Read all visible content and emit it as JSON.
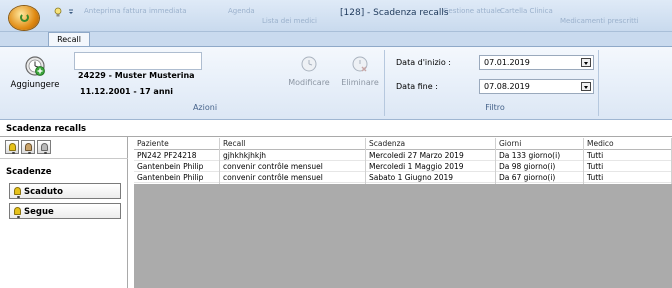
{
  "window": {
    "title": "[128] - Scadenza recalls",
    "ghost_items": [
      "Anteprima fattura immediata",
      "Agenda",
      "Lista dei medici",
      "Gestione attuale",
      "Cartella Clinica",
      "Medicamenti prescritti"
    ]
  },
  "ribbon": {
    "tab_label": "Recall",
    "actions": {
      "add_label": "Aggiungere",
      "patient_name": "24229 - Muster Musterina",
      "patient_dob": "11.12.2001 - 17 anni",
      "edit_label": "Modificare",
      "delete_label": "Eliminare",
      "group_label": "Azioni"
    },
    "filter": {
      "start_label": "Data d'inizio :",
      "start_value": "07.01.2019",
      "end_label": "Data fine :",
      "end_value": "07.08.2019",
      "group_label": "Filtro"
    }
  },
  "section_title": "Scadenza recalls",
  "left_panel": {
    "title": "Scadenze",
    "buttons": [
      "Scaduto",
      "Segue"
    ]
  },
  "grid": {
    "columns": [
      "Paziente",
      "Recall",
      "Scadenza",
      "Giorni",
      "Medico"
    ],
    "rows": [
      [
        "PN242 PF24218",
        "gjhkhkjhkjh",
        "Mercoledi 27 Marzo 2019",
        "Da 133 giorno(i)",
        "Tutti"
      ],
      [
        "Gantenbein Philip",
        "convenir contrôle mensuel",
        "Mercoledi 1 Maggio 2019",
        "Da 98 giorno(i)",
        "Tutti"
      ],
      [
        "Gantenbein Philip",
        "convenir contrôle mensuel",
        "Sabato 1 Giugno 2019",
        "Da 67 giorno(i)",
        "Tutti"
      ]
    ]
  },
  "colors": {
    "ribbon_bg": "#dce7f5",
    "bell_yellow": "#e6c21a",
    "orb_orange": "#e08a12"
  }
}
